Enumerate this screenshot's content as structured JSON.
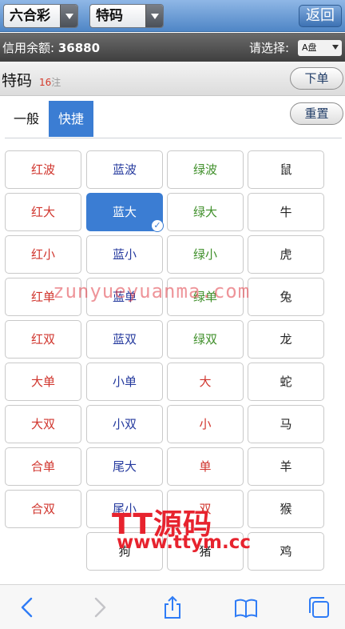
{
  "topbar": {
    "game_select": "六合彩",
    "type_select": "特码",
    "back_label": "返回"
  },
  "credit": {
    "label": "信用余额:",
    "value": "36880",
    "pick_label": "请选择:",
    "pan_value": "A盘"
  },
  "title": {
    "text": "特码",
    "count": "16",
    "count_unit": "注",
    "order_label": "下单"
  },
  "tabs": {
    "normal": "一般",
    "quick": "快捷",
    "reset_label": "重置"
  },
  "grid": {
    "rows": [
      [
        {
          "label": "红波",
          "color": "red"
        },
        {
          "label": "蓝波",
          "color": "blue"
        },
        {
          "label": "绿波",
          "color": "green"
        },
        {
          "label": "鼠",
          "color": "black"
        }
      ],
      [
        {
          "label": "红大",
          "color": "red"
        },
        {
          "label": "蓝大",
          "color": "blue",
          "selected": true
        },
        {
          "label": "绿大",
          "color": "green"
        },
        {
          "label": "牛",
          "color": "black"
        }
      ],
      [
        {
          "label": "红小",
          "color": "red"
        },
        {
          "label": "蓝小",
          "color": "blue"
        },
        {
          "label": "绿小",
          "color": "green"
        },
        {
          "label": "虎",
          "color": "black"
        }
      ],
      [
        {
          "label": "红单",
          "color": "red"
        },
        {
          "label": "蓝单",
          "color": "blue"
        },
        {
          "label": "绿单",
          "color": "green"
        },
        {
          "label": "兔",
          "color": "black"
        }
      ],
      [
        {
          "label": "红双",
          "color": "red"
        },
        {
          "label": "蓝双",
          "color": "blue"
        },
        {
          "label": "绿双",
          "color": "green"
        },
        {
          "label": "龙",
          "color": "black"
        }
      ],
      [
        {
          "label": "大单",
          "color": "red"
        },
        {
          "label": "小单",
          "color": "blue"
        },
        {
          "label": "大",
          "color": "red"
        },
        {
          "label": "蛇",
          "color": "black"
        }
      ],
      [
        {
          "label": "大双",
          "color": "red"
        },
        {
          "label": "小双",
          "color": "blue"
        },
        {
          "label": "小",
          "color": "red"
        },
        {
          "label": "马",
          "color": "black"
        }
      ],
      [
        {
          "label": "合单",
          "color": "red"
        },
        {
          "label": "尾大",
          "color": "blue"
        },
        {
          "label": "单",
          "color": "red"
        },
        {
          "label": "羊",
          "color": "black"
        }
      ],
      [
        {
          "label": "合双",
          "color": "red"
        },
        {
          "label": "尾小",
          "color": "blue"
        },
        {
          "label": "双",
          "color": "red"
        },
        {
          "label": "猴",
          "color": "black"
        }
      ],
      [
        null,
        {
          "label": "狗",
          "color": "black"
        },
        {
          "label": "猪",
          "color": "black"
        },
        {
          "label": "鸡",
          "color": "black"
        }
      ]
    ]
  },
  "watermarks": {
    "url_text": "zunyueyuanma.com",
    "brand_text": "TT源码",
    "brand_url": "www.ttym.cc"
  },
  "toolbar": {
    "icons": [
      "back-icon",
      "forward-icon",
      "share-icon",
      "bookmarks-icon",
      "tabs-icon"
    ]
  },
  "colors": {
    "accent": "#3b7dd3",
    "red": "#d0342c",
    "blue": "#253a9e",
    "green": "#3f8f2a",
    "ios_blue": "#2f7cf6"
  }
}
